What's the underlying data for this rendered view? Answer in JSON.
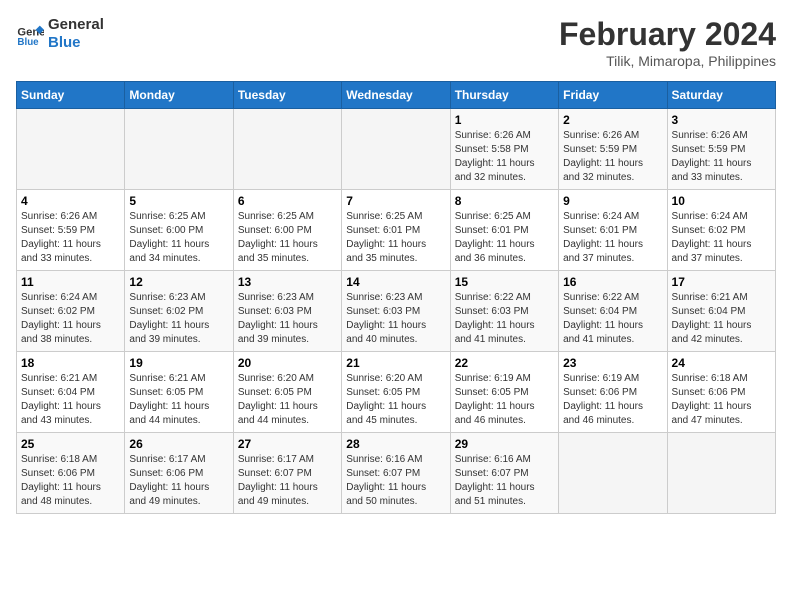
{
  "header": {
    "logo_line1": "General",
    "logo_line2": "Blue",
    "month_title": "February 2024",
    "location": "Tilik, Mimaropa, Philippines"
  },
  "weekdays": [
    "Sunday",
    "Monday",
    "Tuesday",
    "Wednesday",
    "Thursday",
    "Friday",
    "Saturday"
  ],
  "weeks": [
    [
      {
        "day": "",
        "info": ""
      },
      {
        "day": "",
        "info": ""
      },
      {
        "day": "",
        "info": ""
      },
      {
        "day": "",
        "info": ""
      },
      {
        "day": "1",
        "info": "Sunrise: 6:26 AM\nSunset: 5:58 PM\nDaylight: 11 hours\nand 32 minutes."
      },
      {
        "day": "2",
        "info": "Sunrise: 6:26 AM\nSunset: 5:59 PM\nDaylight: 11 hours\nand 32 minutes."
      },
      {
        "day": "3",
        "info": "Sunrise: 6:26 AM\nSunset: 5:59 PM\nDaylight: 11 hours\nand 33 minutes."
      }
    ],
    [
      {
        "day": "4",
        "info": "Sunrise: 6:26 AM\nSunset: 5:59 PM\nDaylight: 11 hours\nand 33 minutes."
      },
      {
        "day": "5",
        "info": "Sunrise: 6:25 AM\nSunset: 6:00 PM\nDaylight: 11 hours\nand 34 minutes."
      },
      {
        "day": "6",
        "info": "Sunrise: 6:25 AM\nSunset: 6:00 PM\nDaylight: 11 hours\nand 35 minutes."
      },
      {
        "day": "7",
        "info": "Sunrise: 6:25 AM\nSunset: 6:01 PM\nDaylight: 11 hours\nand 35 minutes."
      },
      {
        "day": "8",
        "info": "Sunrise: 6:25 AM\nSunset: 6:01 PM\nDaylight: 11 hours\nand 36 minutes."
      },
      {
        "day": "9",
        "info": "Sunrise: 6:24 AM\nSunset: 6:01 PM\nDaylight: 11 hours\nand 37 minutes."
      },
      {
        "day": "10",
        "info": "Sunrise: 6:24 AM\nSunset: 6:02 PM\nDaylight: 11 hours\nand 37 minutes."
      }
    ],
    [
      {
        "day": "11",
        "info": "Sunrise: 6:24 AM\nSunset: 6:02 PM\nDaylight: 11 hours\nand 38 minutes."
      },
      {
        "day": "12",
        "info": "Sunrise: 6:23 AM\nSunset: 6:02 PM\nDaylight: 11 hours\nand 39 minutes."
      },
      {
        "day": "13",
        "info": "Sunrise: 6:23 AM\nSunset: 6:03 PM\nDaylight: 11 hours\nand 39 minutes."
      },
      {
        "day": "14",
        "info": "Sunrise: 6:23 AM\nSunset: 6:03 PM\nDaylight: 11 hours\nand 40 minutes."
      },
      {
        "day": "15",
        "info": "Sunrise: 6:22 AM\nSunset: 6:03 PM\nDaylight: 11 hours\nand 41 minutes."
      },
      {
        "day": "16",
        "info": "Sunrise: 6:22 AM\nSunset: 6:04 PM\nDaylight: 11 hours\nand 41 minutes."
      },
      {
        "day": "17",
        "info": "Sunrise: 6:21 AM\nSunset: 6:04 PM\nDaylight: 11 hours\nand 42 minutes."
      }
    ],
    [
      {
        "day": "18",
        "info": "Sunrise: 6:21 AM\nSunset: 6:04 PM\nDaylight: 11 hours\nand 43 minutes."
      },
      {
        "day": "19",
        "info": "Sunrise: 6:21 AM\nSunset: 6:05 PM\nDaylight: 11 hours\nand 44 minutes."
      },
      {
        "day": "20",
        "info": "Sunrise: 6:20 AM\nSunset: 6:05 PM\nDaylight: 11 hours\nand 44 minutes."
      },
      {
        "day": "21",
        "info": "Sunrise: 6:20 AM\nSunset: 6:05 PM\nDaylight: 11 hours\nand 45 minutes."
      },
      {
        "day": "22",
        "info": "Sunrise: 6:19 AM\nSunset: 6:05 PM\nDaylight: 11 hours\nand 46 minutes."
      },
      {
        "day": "23",
        "info": "Sunrise: 6:19 AM\nSunset: 6:06 PM\nDaylight: 11 hours\nand 46 minutes."
      },
      {
        "day": "24",
        "info": "Sunrise: 6:18 AM\nSunset: 6:06 PM\nDaylight: 11 hours\nand 47 minutes."
      }
    ],
    [
      {
        "day": "25",
        "info": "Sunrise: 6:18 AM\nSunset: 6:06 PM\nDaylight: 11 hours\nand 48 minutes."
      },
      {
        "day": "26",
        "info": "Sunrise: 6:17 AM\nSunset: 6:06 PM\nDaylight: 11 hours\nand 49 minutes."
      },
      {
        "day": "27",
        "info": "Sunrise: 6:17 AM\nSunset: 6:07 PM\nDaylight: 11 hours\nand 49 minutes."
      },
      {
        "day": "28",
        "info": "Sunrise: 6:16 AM\nSunset: 6:07 PM\nDaylight: 11 hours\nand 50 minutes."
      },
      {
        "day": "29",
        "info": "Sunrise: 6:16 AM\nSunset: 6:07 PM\nDaylight: 11 hours\nand 51 minutes."
      },
      {
        "day": "",
        "info": ""
      },
      {
        "day": "",
        "info": ""
      }
    ]
  ]
}
